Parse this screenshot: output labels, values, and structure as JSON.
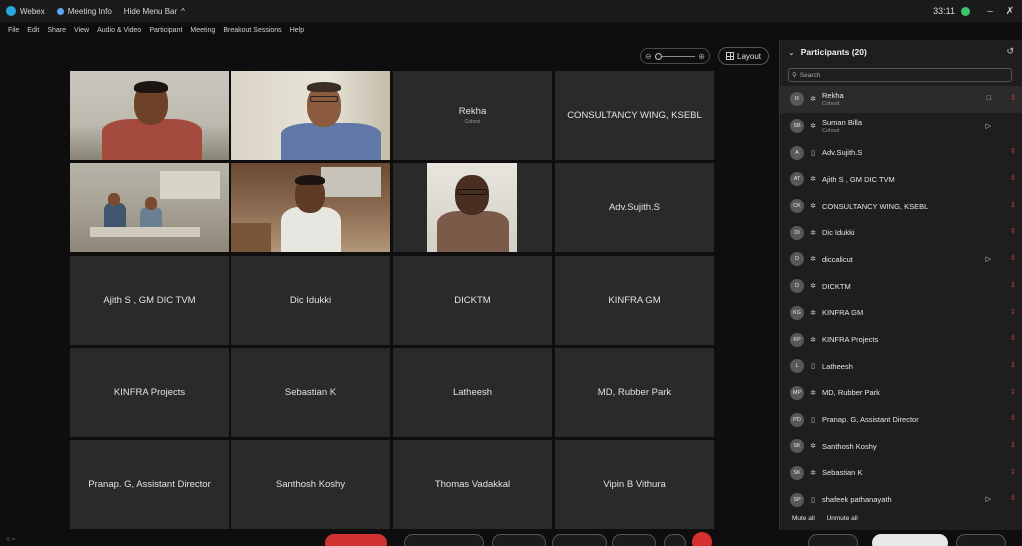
{
  "titlebar": {
    "app_name": "Webex",
    "meeting_info": "Meeting Info",
    "hide_menu": "Hide Menu Bar",
    "timer": "33:11",
    "minimize": "–",
    "close": "✗"
  },
  "menubar": [
    "File",
    "Edit",
    "Share",
    "View",
    "Audio & Video",
    "Participant",
    "Meeting",
    "Breakout Sessions",
    "Help"
  ],
  "video_toolbar": {
    "zoom_minus": "⊖",
    "zoom_plus": "⊕",
    "layout_label": "Layout"
  },
  "grid_tiles": [
    {
      "name": "",
      "role": "",
      "type": "video"
    },
    {
      "name": "",
      "role": "",
      "type": "video"
    },
    {
      "name": "Rekha",
      "role": "Cohost",
      "type": "name"
    },
    {
      "name": "CONSULTANCY WING, KSEBL",
      "role": "",
      "type": "name"
    },
    {
      "name": "",
      "role": "",
      "type": "video"
    },
    {
      "name": "",
      "role": "",
      "type": "video"
    },
    {
      "name": "",
      "role": "",
      "type": "video"
    },
    {
      "name": "Adv.Sujith.S",
      "role": "",
      "type": "name"
    },
    {
      "name": "Ajith S , GM DIC TVM",
      "role": "",
      "type": "name"
    },
    {
      "name": "Dic Idukki",
      "role": "",
      "type": "name"
    },
    {
      "name": "DICKTM",
      "role": "",
      "type": "name"
    },
    {
      "name": "KINFRA GM",
      "role": "",
      "type": "name"
    },
    {
      "name": "KINFRA Projects",
      "role": "",
      "type": "name"
    },
    {
      "name": "Sebastian K",
      "role": "",
      "type": "name"
    },
    {
      "name": "Latheesh",
      "role": "",
      "type": "name"
    },
    {
      "name": "MD, Rubber Park",
      "role": "",
      "type": "name"
    },
    {
      "name": "Pranap. G, Assistant Director",
      "role": "",
      "type": "name"
    },
    {
      "name": "Santhosh Koshy",
      "role": "",
      "type": "name"
    },
    {
      "name": "Thomas Vadakkal",
      "role": "",
      "type": "name"
    },
    {
      "name": "Vipin B Vithura",
      "role": "",
      "type": "name"
    }
  ],
  "participants": {
    "header": "Participants (20)",
    "search_placeholder": "Search",
    "items": [
      {
        "initials": "R",
        "name": "Rekha",
        "sub": "Cohost",
        "device": "✲",
        "muted": true,
        "video": "□"
      },
      {
        "initials": "SB",
        "name": "Suman Billa",
        "sub": "Cohost",
        "device": "✲",
        "muted": false,
        "video": "▷"
      },
      {
        "initials": "A",
        "name": "Adv.Sujith.S",
        "sub": "",
        "device": "▯",
        "muted": true,
        "video": ""
      },
      {
        "initials": "AT",
        "name": "Ajith S , GM DIC TVM",
        "sub": "",
        "device": "✲",
        "muted": true,
        "video": ""
      },
      {
        "initials": "CK",
        "name": "CONSULTANCY WING, KSEBL",
        "sub": "",
        "device": "✲",
        "muted": true,
        "video": ""
      },
      {
        "initials": "DI",
        "name": "Dic Idukki",
        "sub": "",
        "device": "✲",
        "muted": true,
        "video": ""
      },
      {
        "initials": "D",
        "name": "diccalicut",
        "sub": "",
        "device": "✲",
        "muted": true,
        "video": "▷"
      },
      {
        "initials": "D",
        "name": "DICKTM",
        "sub": "",
        "device": "✲",
        "muted": true,
        "video": ""
      },
      {
        "initials": "KG",
        "name": "KINFRA GM",
        "sub": "",
        "device": "✲",
        "muted": true,
        "video": ""
      },
      {
        "initials": "KP",
        "name": "KINFRA Projects",
        "sub": "",
        "device": "✲",
        "muted": true,
        "video": ""
      },
      {
        "initials": "L",
        "name": "Latheesh",
        "sub": "",
        "device": "▯",
        "muted": true,
        "video": ""
      },
      {
        "initials": "MP",
        "name": "MD, Rubber Park",
        "sub": "",
        "device": "✲",
        "muted": true,
        "video": ""
      },
      {
        "initials": "PD",
        "name": "Pranap. G, Assistant Director",
        "sub": "",
        "device": "▯",
        "muted": true,
        "video": ""
      },
      {
        "initials": "SK",
        "name": "Santhosh Koshy",
        "sub": "",
        "device": "✲",
        "muted": true,
        "video": ""
      },
      {
        "initials": "SK",
        "name": "Sebastian K",
        "sub": "",
        "device": "✲",
        "muted": true,
        "video": ""
      },
      {
        "initials": "SP",
        "name": "shafeek pathanayath",
        "sub": "",
        "device": "▯",
        "muted": true,
        "video": "▷"
      }
    ],
    "mute_all": "Mute all",
    "unmute_all": "Unmute all"
  },
  "colors": {
    "mute_red": "#e04444",
    "end_red": "#d6312e",
    "tile_bg": "#2a2a2a"
  }
}
